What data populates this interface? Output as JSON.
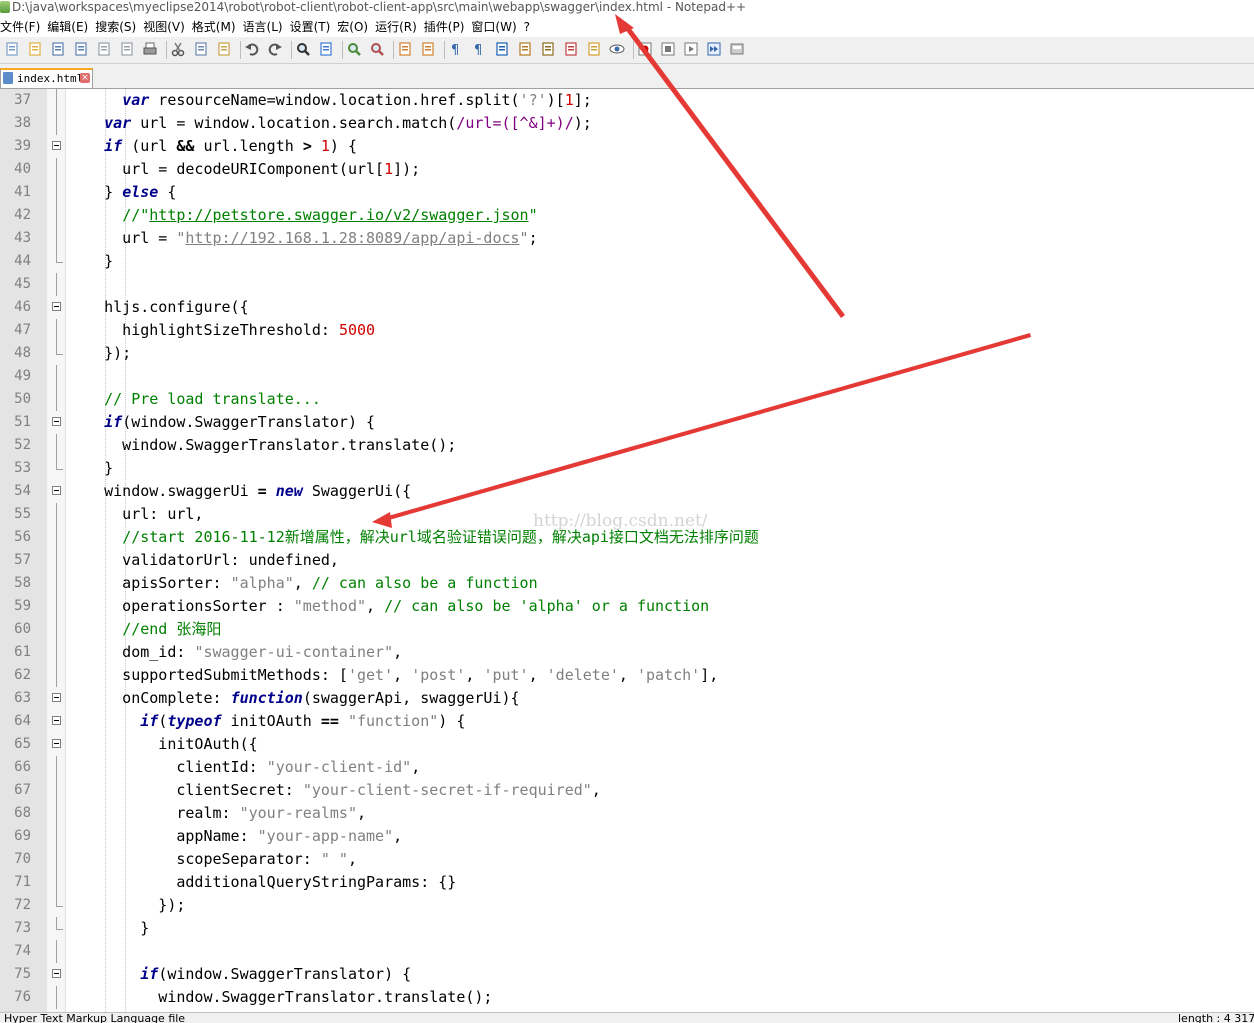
{
  "window": {
    "title": "D:\\java\\workspaces\\myeclipse2014\\robot\\robot-client\\robot-client-app\\src\\main\\webapp\\swagger\\index.html - Notepad++"
  },
  "menubar": {
    "items": [
      {
        "name": "file",
        "label": "文件(F)"
      },
      {
        "name": "edit",
        "label": "编辑(E)"
      },
      {
        "name": "search",
        "label": "搜索(S)"
      },
      {
        "name": "view",
        "label": "视图(V)"
      },
      {
        "name": "format",
        "label": "格式(M)"
      },
      {
        "name": "language",
        "label": "语言(L)"
      },
      {
        "name": "settings",
        "label": "设置(T)"
      },
      {
        "name": "macro",
        "label": "宏(O)"
      },
      {
        "name": "run",
        "label": "运行(R)"
      },
      {
        "name": "plugins",
        "label": "插件(P)"
      },
      {
        "name": "window",
        "label": "窗口(W)"
      },
      {
        "name": "help",
        "label": "?"
      }
    ]
  },
  "toolbar": {
    "icons": [
      "new-file-icon",
      "open-file-icon",
      "save-icon",
      "save-all-icon",
      "close-icon",
      "close-all-icon",
      "print-icon",
      "cut-icon",
      "copy-icon",
      "paste-icon",
      "undo-icon",
      "redo-icon",
      "find-icon",
      "replace-icon",
      "zoom-in-icon",
      "zoom-out-icon",
      "sync-vertical-icon",
      "sync-horizontal-icon",
      "word-wrap-icon",
      "show-all-chars-icon",
      "indent-guide-icon",
      "user-language-icon",
      "document-map-icon",
      "function-list-icon",
      "folder-workspace-icon",
      "monitoring-icon",
      "record-macro-icon",
      "stop-record-icon",
      "play-macro-icon",
      "run-macro-multiple-icon",
      "save-macro-icon"
    ],
    "colors": {
      "record": "#cc0000",
      "accent": "#f9a826"
    }
  },
  "tabs": [
    {
      "label": "index.html",
      "active": true,
      "icon": "file-icon",
      "close_icon": "close-tab-icon"
    }
  ],
  "editor": {
    "watermark": "http://blog.csdn.net/",
    "lines": [
      {
        "n": "37",
        "fold": "line",
        "tokens": [
          {
            "t": "      "
          },
          {
            "t": "var",
            "c": "kw"
          },
          {
            "t": " resourceName=window.location.href.split("
          },
          {
            "t": "'?'",
            "c": "str"
          },
          {
            "t": ")["
          },
          {
            "t": "1",
            "c": "num"
          },
          {
            "t": "];"
          }
        ]
      },
      {
        "n": "38",
        "fold": "line",
        "tokens": [
          {
            "t": "    "
          },
          {
            "t": "var",
            "c": "kw"
          },
          {
            "t": " url = window.location.search.match("
          },
          {
            "t": "/url=([^&]+)/",
            "c": "re"
          },
          {
            "t": ");"
          }
        ]
      },
      {
        "n": "39",
        "fold": "box",
        "tokens": [
          {
            "t": "    "
          },
          {
            "t": "if",
            "c": "kw"
          },
          {
            "t": " (url "
          },
          {
            "t": "&&",
            "c": "op"
          },
          {
            "t": " url.length "
          },
          {
            "t": ">",
            "c": "op"
          },
          {
            "t": " "
          },
          {
            "t": "1",
            "c": "num"
          },
          {
            "t": ") {"
          }
        ]
      },
      {
        "n": "40",
        "fold": "line",
        "tokens": [
          {
            "t": "      url = decodeURIComponent(url["
          },
          {
            "t": "1",
            "c": "num"
          },
          {
            "t": "]);"
          }
        ]
      },
      {
        "n": "41",
        "fold": "line",
        "tokens": [
          {
            "t": "    } "
          },
          {
            "t": "else",
            "c": "kw"
          },
          {
            "t": " {"
          }
        ]
      },
      {
        "n": "42",
        "fold": "line",
        "tokens": [
          {
            "t": "      "
          },
          {
            "t": "//\"",
            "c": "cm"
          },
          {
            "t": "http://petstore.swagger.io/v2/swagger.json",
            "c": "cmurl"
          },
          {
            "t": "\"",
            "c": "cm"
          }
        ]
      },
      {
        "n": "43",
        "fold": "line",
        "tokens": [
          {
            "t": "      url = "
          },
          {
            "t": "\"",
            "c": "str"
          },
          {
            "t": "http://192.168.1.28:8089/app/api-docs",
            "c": "strurl"
          },
          {
            "t": "\"",
            "c": "str"
          },
          {
            "t": ";"
          }
        ]
      },
      {
        "n": "44",
        "fold": "end",
        "tokens": [
          {
            "t": "    }"
          }
        ]
      },
      {
        "n": "45",
        "fold": "line",
        "tokens": []
      },
      {
        "n": "46",
        "fold": "box",
        "tokens": [
          {
            "t": "    hljs.configure({"
          }
        ]
      },
      {
        "n": "47",
        "fold": "line",
        "tokens": [
          {
            "t": "      highlightSizeThreshold: "
          },
          {
            "t": "5000",
            "c": "num"
          }
        ]
      },
      {
        "n": "48",
        "fold": "end",
        "tokens": [
          {
            "t": "    });"
          }
        ]
      },
      {
        "n": "49",
        "fold": "line",
        "tokens": []
      },
      {
        "n": "50",
        "fold": "line",
        "tokens": [
          {
            "t": "    "
          },
          {
            "t": "// Pre load translate...",
            "c": "cm"
          }
        ]
      },
      {
        "n": "51",
        "fold": "box",
        "tokens": [
          {
            "t": "    "
          },
          {
            "t": "if",
            "c": "kw"
          },
          {
            "t": "(window.SwaggerTranslator) {"
          }
        ]
      },
      {
        "n": "52",
        "fold": "line",
        "tokens": [
          {
            "t": "      window.SwaggerTranslator.translate();"
          }
        ]
      },
      {
        "n": "53",
        "fold": "end",
        "tokens": [
          {
            "t": "    }"
          }
        ]
      },
      {
        "n": "54",
        "fold": "box",
        "tokens": [
          {
            "t": "    window.swaggerUi "
          },
          {
            "t": "=",
            "c": "op"
          },
          {
            "t": " "
          },
          {
            "t": "new",
            "c": "kw"
          },
          {
            "t": " SwaggerUi({"
          }
        ]
      },
      {
        "n": "55",
        "fold": "line",
        "tokens": [
          {
            "t": "      url: url,"
          }
        ]
      },
      {
        "n": "56",
        "fold": "line",
        "tokens": [
          {
            "t": "      "
          },
          {
            "t": "//start 2016-11-12新增属性，解决url域名验证错误问题，解决api接口文档无法排序问题",
            "c": "cm"
          }
        ]
      },
      {
        "n": "57",
        "fold": "line",
        "tokens": [
          {
            "t": "      validatorUrl: undefined,"
          }
        ]
      },
      {
        "n": "58",
        "fold": "line",
        "tokens": [
          {
            "t": "      apisSorter: "
          },
          {
            "t": "\"alpha\"",
            "c": "str"
          },
          {
            "t": ", "
          },
          {
            "t": "// can also be a function",
            "c": "cm"
          }
        ]
      },
      {
        "n": "59",
        "fold": "line",
        "tokens": [
          {
            "t": "      operationsSorter : "
          },
          {
            "t": "\"method\"",
            "c": "str"
          },
          {
            "t": ", "
          },
          {
            "t": "// can also be 'alpha' or a function",
            "c": "cm"
          }
        ]
      },
      {
        "n": "60",
        "fold": "line",
        "tokens": [
          {
            "t": "      "
          },
          {
            "t": "//end 张海阳",
            "c": "cm"
          }
        ]
      },
      {
        "n": "61",
        "fold": "line",
        "tokens": [
          {
            "t": "      dom_id: "
          },
          {
            "t": "\"swagger-ui-container\"",
            "c": "str"
          },
          {
            "t": ","
          }
        ]
      },
      {
        "n": "62",
        "fold": "line",
        "tokens": [
          {
            "t": "      supportedSubmitMethods: ["
          },
          {
            "t": "'get'",
            "c": "str"
          },
          {
            "t": ", "
          },
          {
            "t": "'post'",
            "c": "str"
          },
          {
            "t": ", "
          },
          {
            "t": "'put'",
            "c": "str"
          },
          {
            "t": ", "
          },
          {
            "t": "'delete'",
            "c": "str"
          },
          {
            "t": ", "
          },
          {
            "t": "'patch'",
            "c": "str"
          },
          {
            "t": "],"
          }
        ]
      },
      {
        "n": "63",
        "fold": "box",
        "tokens": [
          {
            "t": "      onComplete: "
          },
          {
            "t": "function",
            "c": "kw"
          },
          {
            "t": "(swaggerApi, swaggerUi){"
          }
        ]
      },
      {
        "n": "64",
        "fold": "box",
        "tokens": [
          {
            "t": "        "
          },
          {
            "t": "if",
            "c": "kw"
          },
          {
            "t": "("
          },
          {
            "t": "typeof",
            "c": "kw"
          },
          {
            "t": " initOAuth "
          },
          {
            "t": "==",
            "c": "op"
          },
          {
            "t": " "
          },
          {
            "t": "\"function\"",
            "c": "str"
          },
          {
            "t": ") {"
          }
        ]
      },
      {
        "n": "65",
        "fold": "box",
        "tokens": [
          {
            "t": "          initOAuth({"
          }
        ]
      },
      {
        "n": "66",
        "fold": "line",
        "tokens": [
          {
            "t": "            clientId: "
          },
          {
            "t": "\"your-client-id\"",
            "c": "str"
          },
          {
            "t": ","
          }
        ]
      },
      {
        "n": "67",
        "fold": "line",
        "tokens": [
          {
            "t": "            clientSecret: "
          },
          {
            "t": "\"your-client-secret-if-required\"",
            "c": "str"
          },
          {
            "t": ","
          }
        ]
      },
      {
        "n": "68",
        "fold": "line",
        "tokens": [
          {
            "t": "            realm: "
          },
          {
            "t": "\"your-realms\"",
            "c": "str"
          },
          {
            "t": ","
          }
        ]
      },
      {
        "n": "69",
        "fold": "line",
        "tokens": [
          {
            "t": "            appName: "
          },
          {
            "t": "\"your-app-name\"",
            "c": "str"
          },
          {
            "t": ","
          }
        ]
      },
      {
        "n": "70",
        "fold": "line",
        "tokens": [
          {
            "t": "            scopeSeparator: "
          },
          {
            "t": "\" \"",
            "c": "str"
          },
          {
            "t": ","
          }
        ]
      },
      {
        "n": "71",
        "fold": "line",
        "tokens": [
          {
            "t": "            additionalQueryStringParams: {}"
          }
        ]
      },
      {
        "n": "72",
        "fold": "end",
        "tokens": [
          {
            "t": "          });"
          }
        ]
      },
      {
        "n": "73",
        "fold": "end",
        "tokens": [
          {
            "t": "        }"
          }
        ]
      },
      {
        "n": "74",
        "fold": "line",
        "tokens": []
      },
      {
        "n": "75",
        "fold": "box",
        "tokens": [
          {
            "t": "        "
          },
          {
            "t": "if",
            "c": "kw"
          },
          {
            "t": "(window.SwaggerTranslator) {"
          }
        ]
      },
      {
        "n": "76",
        "fold": "line",
        "tokens": [
          {
            "t": "          window.SwaggerTranslator.translate();"
          }
        ]
      }
    ]
  },
  "statusbar": {
    "left": "Hyper Text Markup Language file",
    "right": "length : 4 317"
  },
  "annotation": {
    "arrow_color": "#e53935"
  }
}
